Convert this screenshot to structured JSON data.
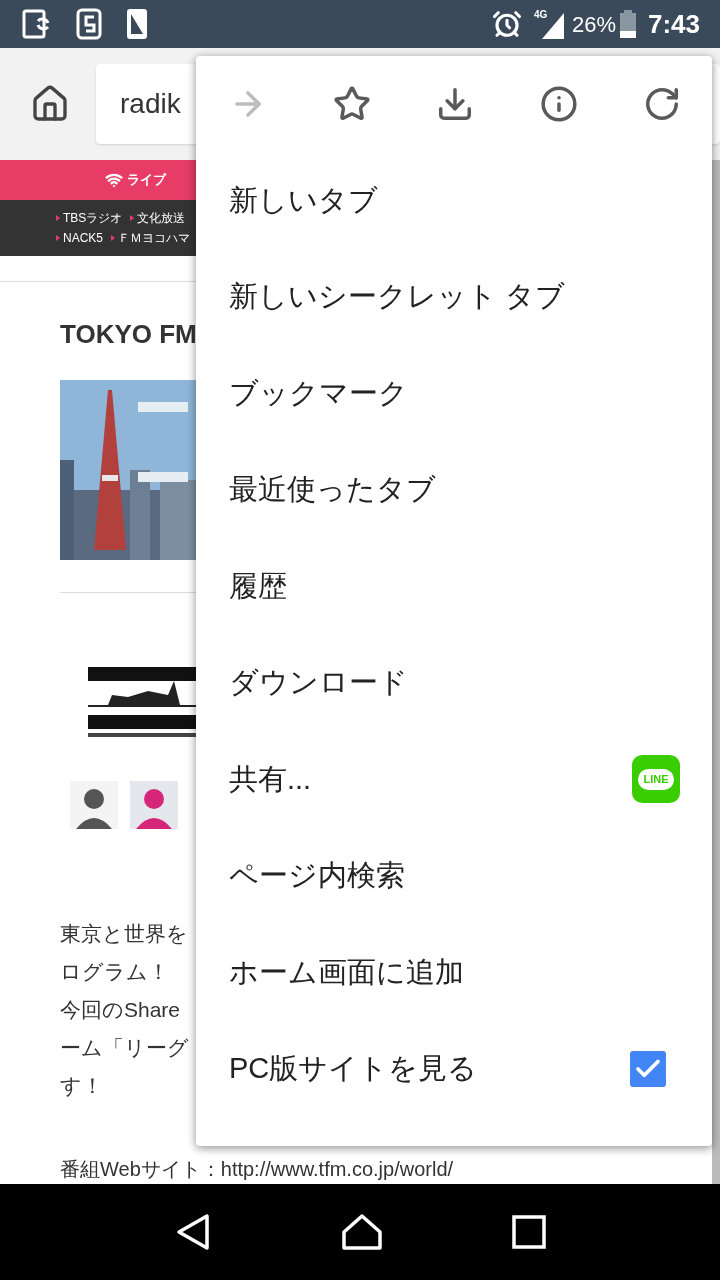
{
  "status_bar": {
    "battery": "26%",
    "time": "7:43",
    "network": "4G"
  },
  "toolbar": {
    "url": "radik"
  },
  "site": {
    "nav_label": "ライブ",
    "stations": [
      [
        "TBSラジオ",
        "文化放送"
      ],
      [
        "NACK5",
        "ＦＭヨコハマ"
      ]
    ],
    "title": "TOKYO FM",
    "body_lines": [
      "東京と世界を",
      "ログラム！",
      "今回のShare",
      "ーム「リーグ",
      "す！"
    ],
    "web_line": "番組Webサイト：http://www.tfm.co.jp/world/"
  },
  "menu": {
    "actions": [
      {
        "kind": "forward",
        "disabled": true
      },
      {
        "kind": "bookmark",
        "disabled": false
      },
      {
        "kind": "download",
        "disabled": false
      },
      {
        "kind": "info",
        "disabled": false
      },
      {
        "kind": "reload",
        "disabled": false
      }
    ],
    "items": [
      {
        "label": "新しいタブ",
        "kind": "plain"
      },
      {
        "label": "新しいシークレット タブ",
        "kind": "plain"
      },
      {
        "label": "ブックマーク",
        "kind": "plain"
      },
      {
        "label": "最近使ったタブ",
        "kind": "plain"
      },
      {
        "label": "履歴",
        "kind": "plain"
      },
      {
        "label": "ダウンロード",
        "kind": "plain"
      },
      {
        "label": "共有...",
        "kind": "share",
        "app": "LINE"
      },
      {
        "label": "ページ内検索",
        "kind": "plain"
      },
      {
        "label": "ホーム画面に追加",
        "kind": "plain"
      },
      {
        "label": "PC版サイトを見る",
        "kind": "checkbox",
        "checked": true
      }
    ]
  }
}
